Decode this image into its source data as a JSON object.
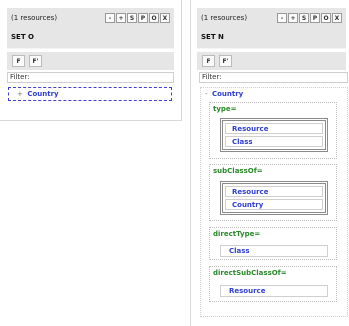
{
  "panel_o": {
    "resource_count": "(1 resources)",
    "toolbar_buttons": [
      "-",
      "+",
      "S",
      "P",
      "O",
      "X"
    ],
    "set_title": "SET O",
    "f_buttons": [
      "F",
      "F'"
    ],
    "filter_label": "Filter:",
    "tree": {
      "toggle": "+",
      "label": "Country"
    }
  },
  "panel_n": {
    "resource_count": "(1 resources)",
    "toolbar_buttons": [
      "-",
      "+",
      "S",
      "P",
      "O",
      "X"
    ],
    "set_title": "SET N",
    "f_buttons": [
      "F",
      "F'"
    ],
    "filter_label": "Filter:",
    "tree": {
      "toggle": "-",
      "label": "Country",
      "properties": [
        {
          "label": "type=",
          "values": [
            "Resource",
            "Class"
          ]
        },
        {
          "label": "subClassOf=",
          "values": [
            "Resource",
            "Country"
          ]
        },
        {
          "label": "directType=",
          "values": [
            "Class"
          ]
        },
        {
          "label": "directSubClassOf=",
          "values": [
            "Resource"
          ]
        }
      ]
    }
  },
  "colors": {
    "resource_link": "#2f3fd0",
    "property_label": "#2a8a2a",
    "toolbar_bg": "#e6e6e6"
  }
}
